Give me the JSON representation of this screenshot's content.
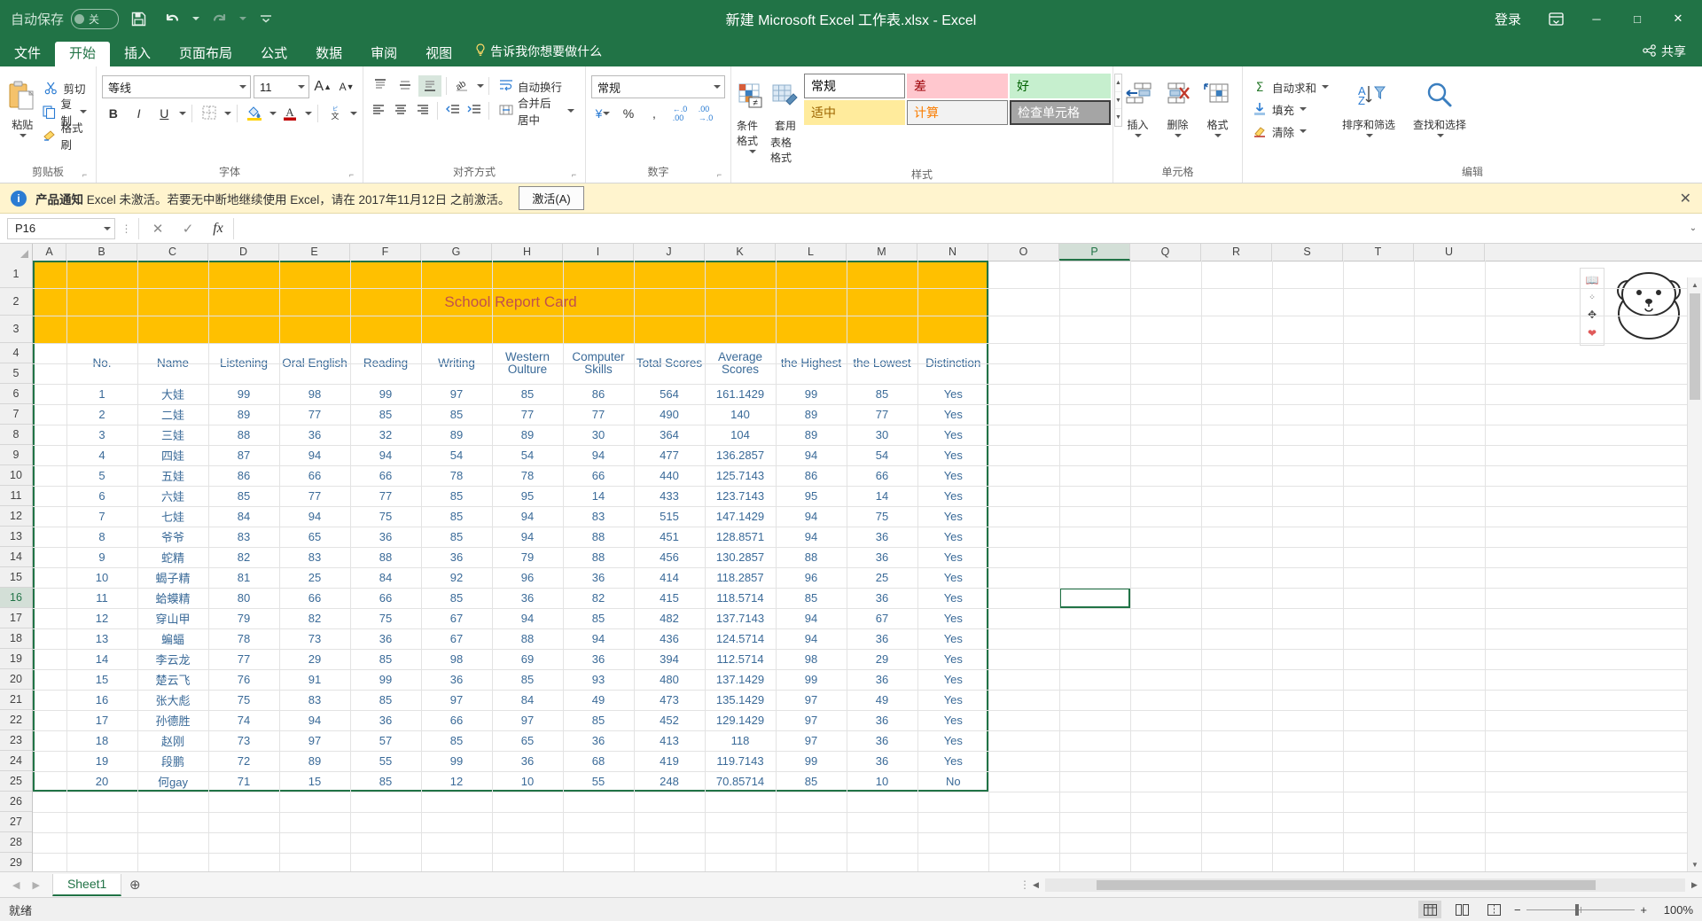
{
  "titlebar": {
    "autosave_label": "自动保存",
    "autosave_state": "关",
    "document_title": "新建 Microsoft Excel 工作表.xlsx - Excel",
    "signin_label": "登录",
    "save_icon": "save-icon",
    "undo_icon": "undo-icon",
    "redo_icon": "redo-icon",
    "customize_icon": "customize-quick-access-icon",
    "ribbon_display_icon": "ribbon-display-options-icon",
    "minimize_label": "─",
    "maximize_label": "□",
    "close_label": "✕"
  },
  "tabs": [
    {
      "label": "文件",
      "active": false
    },
    {
      "label": "开始",
      "active": true
    },
    {
      "label": "插入",
      "active": false
    },
    {
      "label": "页面布局",
      "active": false
    },
    {
      "label": "公式",
      "active": false
    },
    {
      "label": "数据",
      "active": false
    },
    {
      "label": "审阅",
      "active": false
    },
    {
      "label": "视图",
      "active": false
    }
  ],
  "tellme": "告诉我你想要做什么",
  "share_label": "共享",
  "ribbon": {
    "clipboard": {
      "group_label": "剪贴板",
      "paste": "粘贴",
      "cut": "剪切",
      "copy": "复制",
      "format_painter": "格式刷"
    },
    "font": {
      "group_label": "字体",
      "font_name": "等线",
      "font_size": "11",
      "grow_label": "A",
      "shrink_label": "A",
      "bold": "B",
      "italic": "I",
      "underline": "U",
      "border_icon": "borders-icon",
      "fill_icon": "fill-color-icon",
      "fontcolor_icon": "font-color-icon",
      "phonetic_icon": "phonetic-guide-icon"
    },
    "alignment": {
      "group_label": "对齐方式",
      "wrap_text": "自动换行",
      "merge_center": "合并后居中",
      "orientation_icon": "text-orientation-icon",
      "indent_decrease_icon": "decrease-indent-icon",
      "indent_increase_icon": "increase-indent-icon"
    },
    "number": {
      "group_label": "数字",
      "format": "常规",
      "currency": "¥",
      "percent": "%",
      "comma": ",",
      "increase_decimal": ".00",
      "decrease_decimal": ".0"
    },
    "styles": {
      "group_label": "样式",
      "conditional_formatting": "条件格式",
      "format_as_table_l1": "套用",
      "format_as_table_l2": "表格格式",
      "cells": [
        {
          "label": "常规",
          "bg": "#ffffff",
          "fg": "#000000",
          "border": "#7f7f7f"
        },
        {
          "label": "差",
          "bg": "#ffc7ce",
          "fg": "#9c0006",
          "border": "#ffc7ce"
        },
        {
          "label": "好",
          "bg": "#c6efce",
          "fg": "#006100",
          "border": "#c6efce"
        },
        {
          "label": "适中",
          "bg": "#ffeb9c",
          "fg": "#9c6500",
          "border": "#ffeb9c"
        },
        {
          "label": "计算",
          "bg": "#f2f2f2",
          "fg": "#fa7d00",
          "border": "#7f7f7f"
        },
        {
          "label": "检查单元格",
          "bg": "#a5a5a5",
          "fg": "#ffffff",
          "border": "#3f3f3f"
        }
      ]
    },
    "cells": {
      "group_label": "单元格",
      "insert": "插入",
      "delete": "删除",
      "format": "格式"
    },
    "editing": {
      "group_label": "编辑",
      "autosum": "自动求和",
      "fill": "填充",
      "clear": "清除",
      "sort_filter": "排序和筛选",
      "find_select": "查找和选择"
    }
  },
  "notice": {
    "title": "产品通知",
    "message": "Excel 未激活。若要无中断地继续使用 Excel，请在 2017年11月12日 之前激活。",
    "button": "激活(A)",
    "close": "✕",
    "info_icon": "info-icon"
  },
  "formula_bar": {
    "name_box": "P16",
    "cancel_icon": "cancel-icon",
    "enter_icon": "confirm-icon",
    "function_icon": "insert-function-icon",
    "formula_value": "",
    "expand_icon": "expand-formula-bar-icon"
  },
  "grid": {
    "columns": [
      "A",
      "B",
      "C",
      "D",
      "E",
      "F",
      "G",
      "H",
      "I",
      "J",
      "K",
      "L",
      "M",
      "N",
      "O",
      "P",
      "Q",
      "R",
      "S",
      "T",
      "U"
    ],
    "selected_column": "P",
    "rows": [
      1,
      2,
      3,
      4,
      5,
      6,
      7,
      8,
      9,
      10,
      11,
      12,
      13,
      14,
      15,
      16,
      17,
      18,
      19,
      20,
      21,
      22,
      23,
      24,
      25,
      26,
      27,
      28,
      29
    ],
    "selected_row": 16,
    "active_cell": "P16",
    "banner_title": "School Report Card",
    "headers": [
      "No.",
      "Name",
      "Listening",
      "Oral English",
      "Reading",
      "Writing",
      "Western Oulture",
      "Computer Skills",
      "Total Scores",
      "Average Scores",
      "the Highest",
      "the Lowest",
      "Distinction"
    ],
    "data": [
      [
        "1",
        "大娃",
        "99",
        "98",
        "99",
        "97",
        "85",
        "86",
        "564",
        "161.1429",
        "99",
        "85",
        "Yes"
      ],
      [
        "2",
        "二娃",
        "89",
        "77",
        "85",
        "85",
        "77",
        "77",
        "490",
        "140",
        "89",
        "77",
        "Yes"
      ],
      [
        "3",
        "三娃",
        "88",
        "36",
        "32",
        "89",
        "89",
        "30",
        "364",
        "104",
        "89",
        "30",
        "Yes"
      ],
      [
        "4",
        "四娃",
        "87",
        "94",
        "94",
        "54",
        "54",
        "94",
        "477",
        "136.2857",
        "94",
        "54",
        "Yes"
      ],
      [
        "5",
        "五娃",
        "86",
        "66",
        "66",
        "78",
        "78",
        "66",
        "440",
        "125.7143",
        "86",
        "66",
        "Yes"
      ],
      [
        "6",
        "六娃",
        "85",
        "77",
        "77",
        "85",
        "95",
        "14",
        "433",
        "123.7143",
        "95",
        "14",
        "Yes"
      ],
      [
        "7",
        "七娃",
        "84",
        "94",
        "75",
        "85",
        "94",
        "83",
        "515",
        "147.1429",
        "94",
        "75",
        "Yes"
      ],
      [
        "8",
        "爷爷",
        "83",
        "65",
        "36",
        "85",
        "94",
        "88",
        "451",
        "128.8571",
        "94",
        "36",
        "Yes"
      ],
      [
        "9",
        "蛇精",
        "82",
        "83",
        "88",
        "36",
        "79",
        "88",
        "456",
        "130.2857",
        "88",
        "36",
        "Yes"
      ],
      [
        "10",
        "蝎子精",
        "81",
        "25",
        "84",
        "92",
        "96",
        "36",
        "414",
        "118.2857",
        "96",
        "25",
        "Yes"
      ],
      [
        "11",
        "蛤蟆精",
        "80",
        "66",
        "66",
        "85",
        "36",
        "82",
        "415",
        "118.5714",
        "85",
        "36",
        "Yes"
      ],
      [
        "12",
        "穿山甲",
        "79",
        "82",
        "75",
        "67",
        "94",
        "85",
        "482",
        "137.7143",
        "94",
        "67",
        "Yes"
      ],
      [
        "13",
        "蝙蝠",
        "78",
        "73",
        "36",
        "67",
        "88",
        "94",
        "436",
        "124.5714",
        "94",
        "36",
        "Yes"
      ],
      [
        "14",
        "李云龙",
        "77",
        "29",
        "85",
        "98",
        "69",
        "36",
        "394",
        "112.5714",
        "98",
        "29",
        "Yes"
      ],
      [
        "15",
        "楚云飞",
        "76",
        "91",
        "99",
        "36",
        "85",
        "93",
        "480",
        "137.1429",
        "99",
        "36",
        "Yes"
      ],
      [
        "16",
        "张大彪",
        "75",
        "83",
        "85",
        "97",
        "84",
        "49",
        "473",
        "135.1429",
        "97",
        "49",
        "Yes"
      ],
      [
        "17",
        "孙德胜",
        "74",
        "94",
        "36",
        "66",
        "97",
        "85",
        "452",
        "129.1429",
        "97",
        "36",
        "Yes"
      ],
      [
        "18",
        "赵刚",
        "73",
        "97",
        "57",
        "85",
        "65",
        "36",
        "413",
        "118",
        "97",
        "36",
        "Yes"
      ],
      [
        "19",
        "段鹏",
        "72",
        "89",
        "55",
        "99",
        "36",
        "68",
        "419",
        "119.7143",
        "99",
        "36",
        "Yes"
      ],
      [
        "20",
        "何gay",
        "71",
        "15",
        "85",
        "12",
        "10",
        "55",
        "248",
        "70.85714",
        "85",
        "10",
        "No"
      ]
    ]
  },
  "sheet_tabs": {
    "tabs": [
      "Sheet1"
    ],
    "active": "Sheet1",
    "add_label": "+",
    "prev_icon": "nav-prev-icon",
    "next_icon": "nav-next-icon"
  },
  "status_bar": {
    "state": "就绪",
    "zoom": "100%",
    "view_normal_icon": "view-normal-icon",
    "view_pagelayout_icon": "view-page-layout-icon",
    "view_pagebreak_icon": "view-page-break-icon",
    "zoom_out": "−",
    "zoom_in": "+"
  }
}
